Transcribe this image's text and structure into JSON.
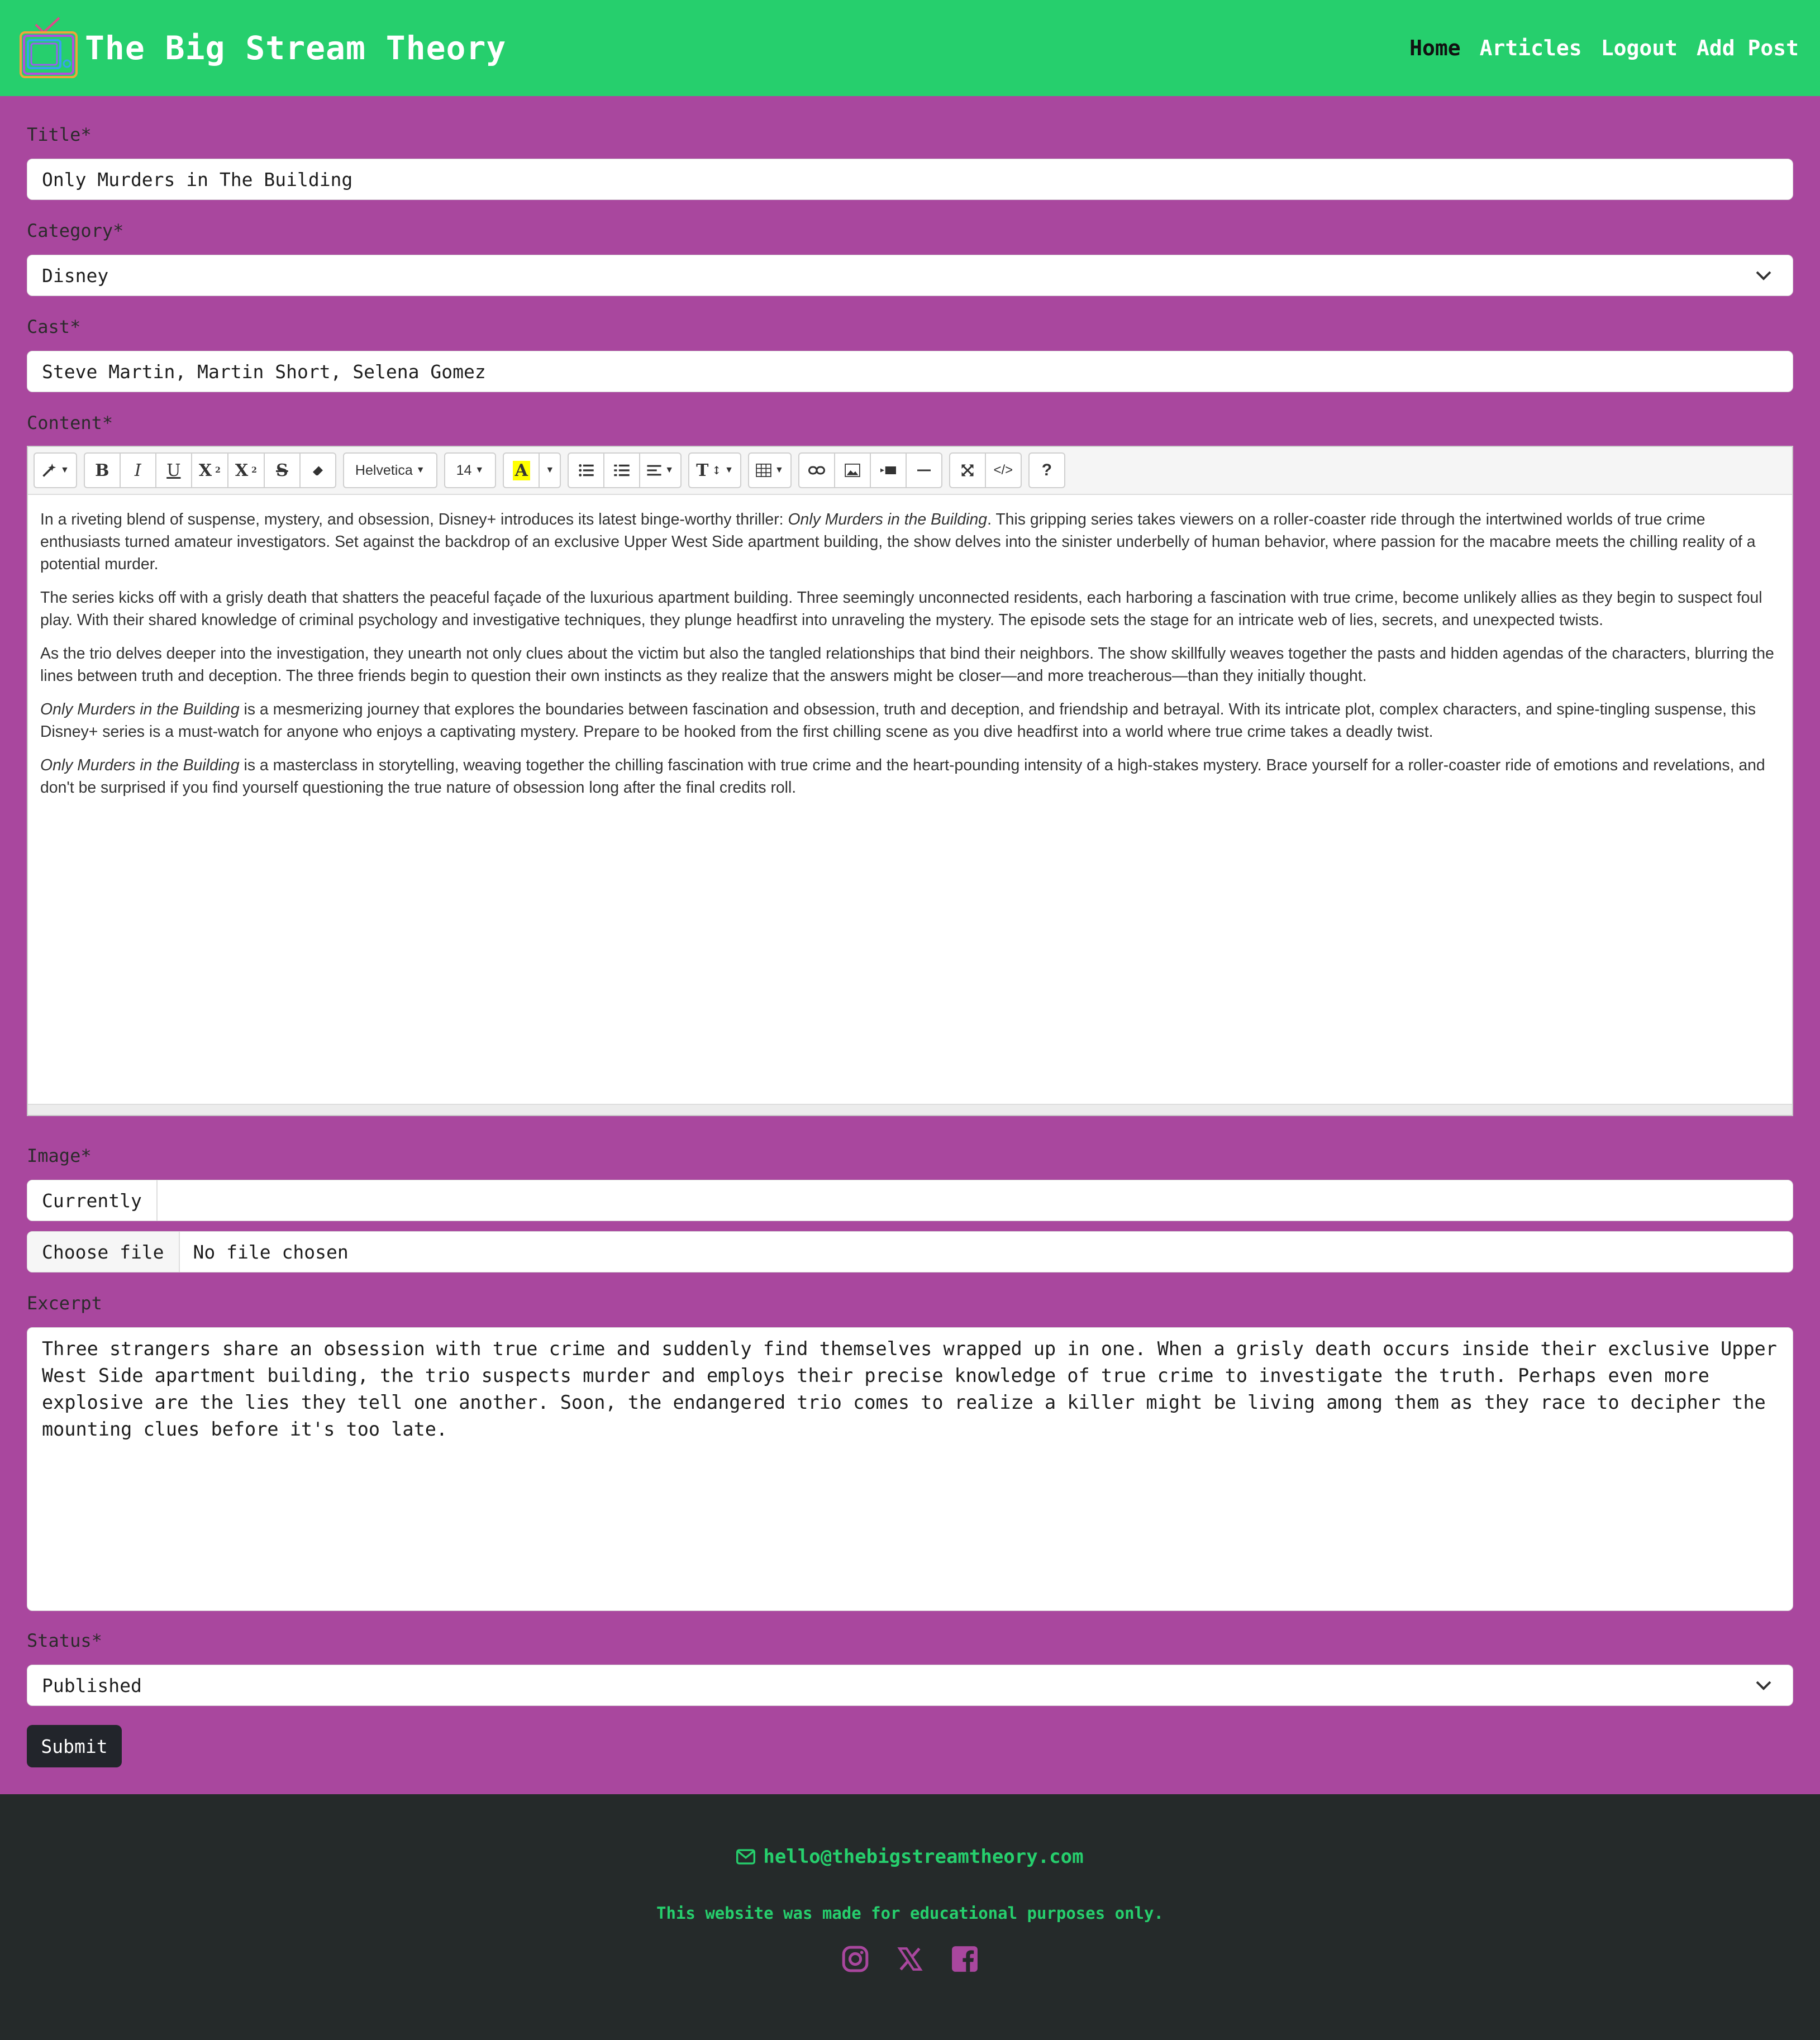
{
  "header": {
    "brand": "The Big Stream Theory",
    "nav": [
      {
        "label": "Home",
        "active": true
      },
      {
        "label": "Articles",
        "active": false
      },
      {
        "label": "Logout",
        "active": false
      },
      {
        "label": "Add Post",
        "active": false
      }
    ]
  },
  "form": {
    "title_label": "Title*",
    "title_value": "Only Murders in The Building",
    "category_label": "Category*",
    "category_value": "Disney",
    "cast_label": "Cast*",
    "cast_value": "Steve Martin, Martin Short, Selena Gomez",
    "content_label": "Content*",
    "image_label": "Image*",
    "image_currently": "Currently",
    "choose_file": "Choose file",
    "no_file": "No file chosen",
    "excerpt_label": "Excerpt",
    "excerpt_value": "Three strangers share an obsession with true crime and suddenly find themselves wrapped up in one. When a grisly death occurs inside their exclusive Upper West Side apartment building, the trio suspects murder and employs their precise knowledge of true crime to investigate the truth. Perhaps even more explosive are the lies they tell one another. Soon, the endangered trio comes to realize a killer might be living among them as they race to decipher the mounting clues before it's too late.",
    "status_label": "Status*",
    "status_value": "Published",
    "submit_label": "Submit"
  },
  "editor": {
    "font_name": "Helvetica",
    "font_size": "14",
    "highlight_glyph": "A",
    "toolbar_icons": [
      "magic-icon",
      "bold-icon",
      "italic-icon",
      "underline-icon",
      "superscript-icon",
      "subscript-icon",
      "strikethrough-icon",
      "eraser-icon",
      "font-name-dropdown",
      "font-size-dropdown",
      "highlight-icon",
      "unordered-list-icon",
      "ordered-list-icon",
      "align-icon",
      "line-height-icon",
      "table-icon",
      "link-icon",
      "picture-icon",
      "video-icon",
      "horizontal-rule-icon",
      "fullscreen-icon",
      "code-view-icon",
      "help-icon"
    ],
    "paragraphs": [
      {
        "pre": "In a riveting blend of suspense, mystery, and obsession, Disney+ introduces its latest binge-worthy thriller: ",
        "em": "Only Murders in the Building",
        "post": ". This gripping series takes viewers on a roller-coaster ride through the intertwined worlds of true crime enthusiasts turned amateur investigators. Set against the backdrop of an exclusive Upper West Side apartment building, the show delves into the sinister underbelly of human behavior, where passion for the macabre meets the chilling reality of a potential murder."
      },
      {
        "pre": "The series kicks off with a grisly death that shatters the peaceful façade of the luxurious apartment building. Three seemingly unconnected residents, each harboring a fascination with true crime, become unlikely allies as they begin to suspect foul play. With their shared knowledge of criminal psychology and investigative techniques, they plunge headfirst into unraveling the mystery. The episode sets the stage for an intricate web of lies, secrets, and unexpected twists.",
        "em": "",
        "post": ""
      },
      {
        "pre": "As the trio delves deeper into the investigation, they unearth not only clues about the victim but also the tangled relationships that bind their neighbors. The show skillfully weaves together the pasts and hidden agendas of the characters, blurring the lines between truth and deception. The three friends begin to question their own instincts as they realize that the answers might be closer—and more treacherous—than they initially thought.",
        "em": "",
        "post": ""
      },
      {
        "pre": "",
        "em": "Only Murders in the Building",
        "post": " is a mesmerizing journey that explores the boundaries between fascination and obsession, truth and deception, and friendship and betrayal. With its intricate plot, complex characters, and spine-tingling suspense, this Disney+ series is a must-watch for anyone who enjoys a captivating mystery. Prepare to be hooked from the first chilling scene as you dive headfirst into a world where true crime takes a deadly twist."
      },
      {
        "pre": "",
        "em": "Only Murders in the Building",
        "post": " is a masterclass in storytelling, weaving together the chilling fascination with true crime and the heart-pounding intensity of a high-stakes mystery. Brace yourself for a roller-coaster ride of emotions and revelations, and don't be surprised if you find yourself questioning the true nature of obsession long after the final credits roll."
      }
    ]
  },
  "footer": {
    "email": "hello@thebigstreamtheory.com",
    "note": "This website was made for educational purposes only.",
    "social_icons": [
      "instagram-icon",
      "x-twitter-icon",
      "facebook-icon"
    ]
  },
  "colors": {
    "navbar": "#26cf6d",
    "page_bg": "#a9479e",
    "footer_bg": "#252a2a",
    "footer_text": "#26cf6d",
    "social_icon": "#a9479e",
    "submit_bg": "#22252b"
  }
}
